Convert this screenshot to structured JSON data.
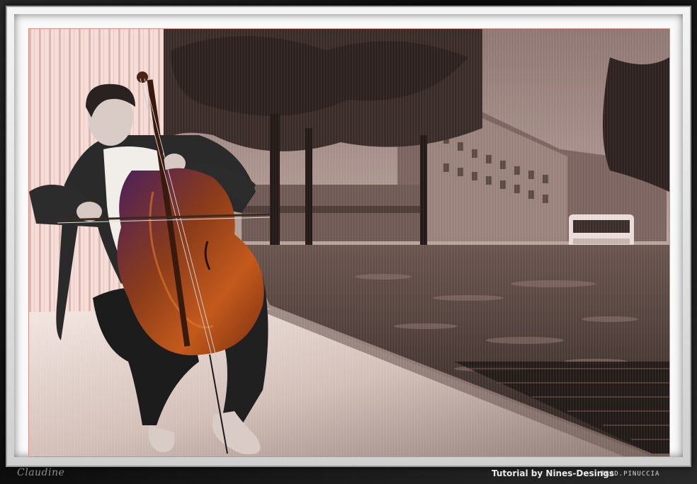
{
  "image": {
    "subject": "cellist-on-rainy-street-artwork"
  },
  "signature": "Claudine",
  "credits": {
    "tutorial": "Tutorial by Nines-Desings",
    "translation": "TRAD.PINUCCIA"
  },
  "colors": {
    "frame_dark": "#111111",
    "frame_light": "#f2f2f2",
    "pink_border": "#d08f86",
    "sepia": "#9b8079",
    "cello": "#b14a15"
  }
}
